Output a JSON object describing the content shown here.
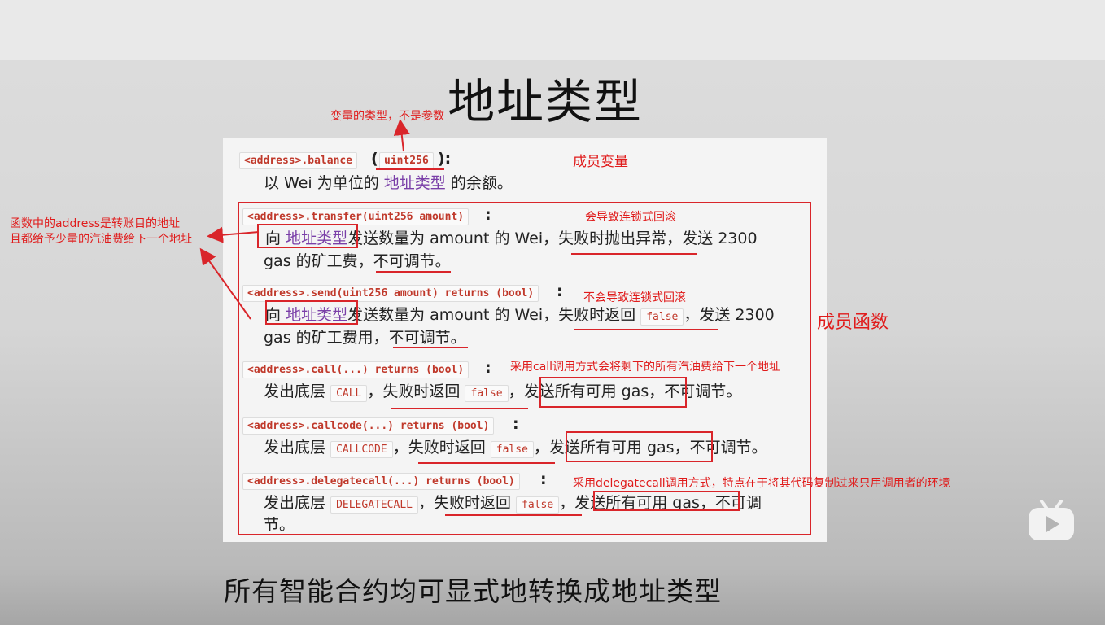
{
  "slide": {
    "title": "地址类型",
    "footer": "所有智能合约均可显式地转换成地址类型"
  },
  "annotations": {
    "type_note": "变量的类型，不是参数",
    "member_variable": "成员变量",
    "member_functions": "成员函数",
    "transfer_note": "会导致连锁式回滚",
    "send_note": "不会导致连锁式回滚",
    "call_note": "采用call调用方式会将剩下的所有汽油费给下一个地址",
    "delegatecall_note": "采用delegatecall调用方式，特点在于将其代码复制过来只用调用者的环境",
    "left_note_line1": "函数中的address是转账目的地址",
    "left_note_line2": "且都给予少量的汽油费给下一个地址"
  },
  "doc": {
    "balance": {
      "sig": "<address>.balance",
      "open": "(",
      "type": "uint256",
      "close": "):",
      "desc_a": "以 Wei 为单位的",
      "desc_link": "地址类型",
      "desc_b": "的余额。"
    },
    "transfer": {
      "sig": "<address>.transfer(uint256 amount)",
      "colon": ":",
      "l1_a": "向",
      "l1_link": "地址类型",
      "l1_b": "发送数量为 amount 的 Wei，",
      "l1_c": "失败时抛出异常",
      "l1_d": "，发送 2300",
      "l2_a": "gas 的矿工费，",
      "l2_b": "不可调节。"
    },
    "send": {
      "sig": "<address>.send(uint256 amount) returns (bool)",
      "colon": ":",
      "l1_a": "向",
      "l1_link": "地址类型",
      "l1_b": "发送数量为 amount 的 Wei，",
      "l1_c": "失败时返回",
      "l1_code": "false",
      "l1_d": "，发送 2300",
      "l2_a": "gas 的矿工费用，",
      "l2_b": "不可调节。"
    },
    "call": {
      "sig": "<address>.call(...) returns (bool)",
      "colon": ":",
      "a": "发出底层",
      "code1": "CALL",
      "b": "，",
      "c": "失败时返回",
      "code2": "false",
      "d": "，",
      "e": "发送所有可用 gas，",
      "f": "不可调节。"
    },
    "callcode": {
      "sig": "<address>.callcode(...) returns (bool)",
      "colon": ":",
      "a": "发出底层",
      "code1": "CALLCODE",
      "b": "，",
      "c": "失败时返回",
      "code2": "false",
      "d": "，",
      "e": "发送所有可用 gas，",
      "f": "不可调节。"
    },
    "delegatecall": {
      "sig": "<address>.delegatecall(...) returns (bool)",
      "colon": ":",
      "a": "发出底层",
      "code1": "DELEGATECALL",
      "b": "，",
      "c": "失败时返回",
      "code2": "false",
      "d": "，",
      "e": "发送所有可用 gas，",
      "f": "不可调",
      "g": "节。"
    }
  },
  "icons": {
    "player_logo": "bilibili-tv-icon"
  },
  "colors": {
    "annotation_red": "#e01b1b",
    "link_purple": "#7a3fa8",
    "code_red": "#c0392b"
  }
}
